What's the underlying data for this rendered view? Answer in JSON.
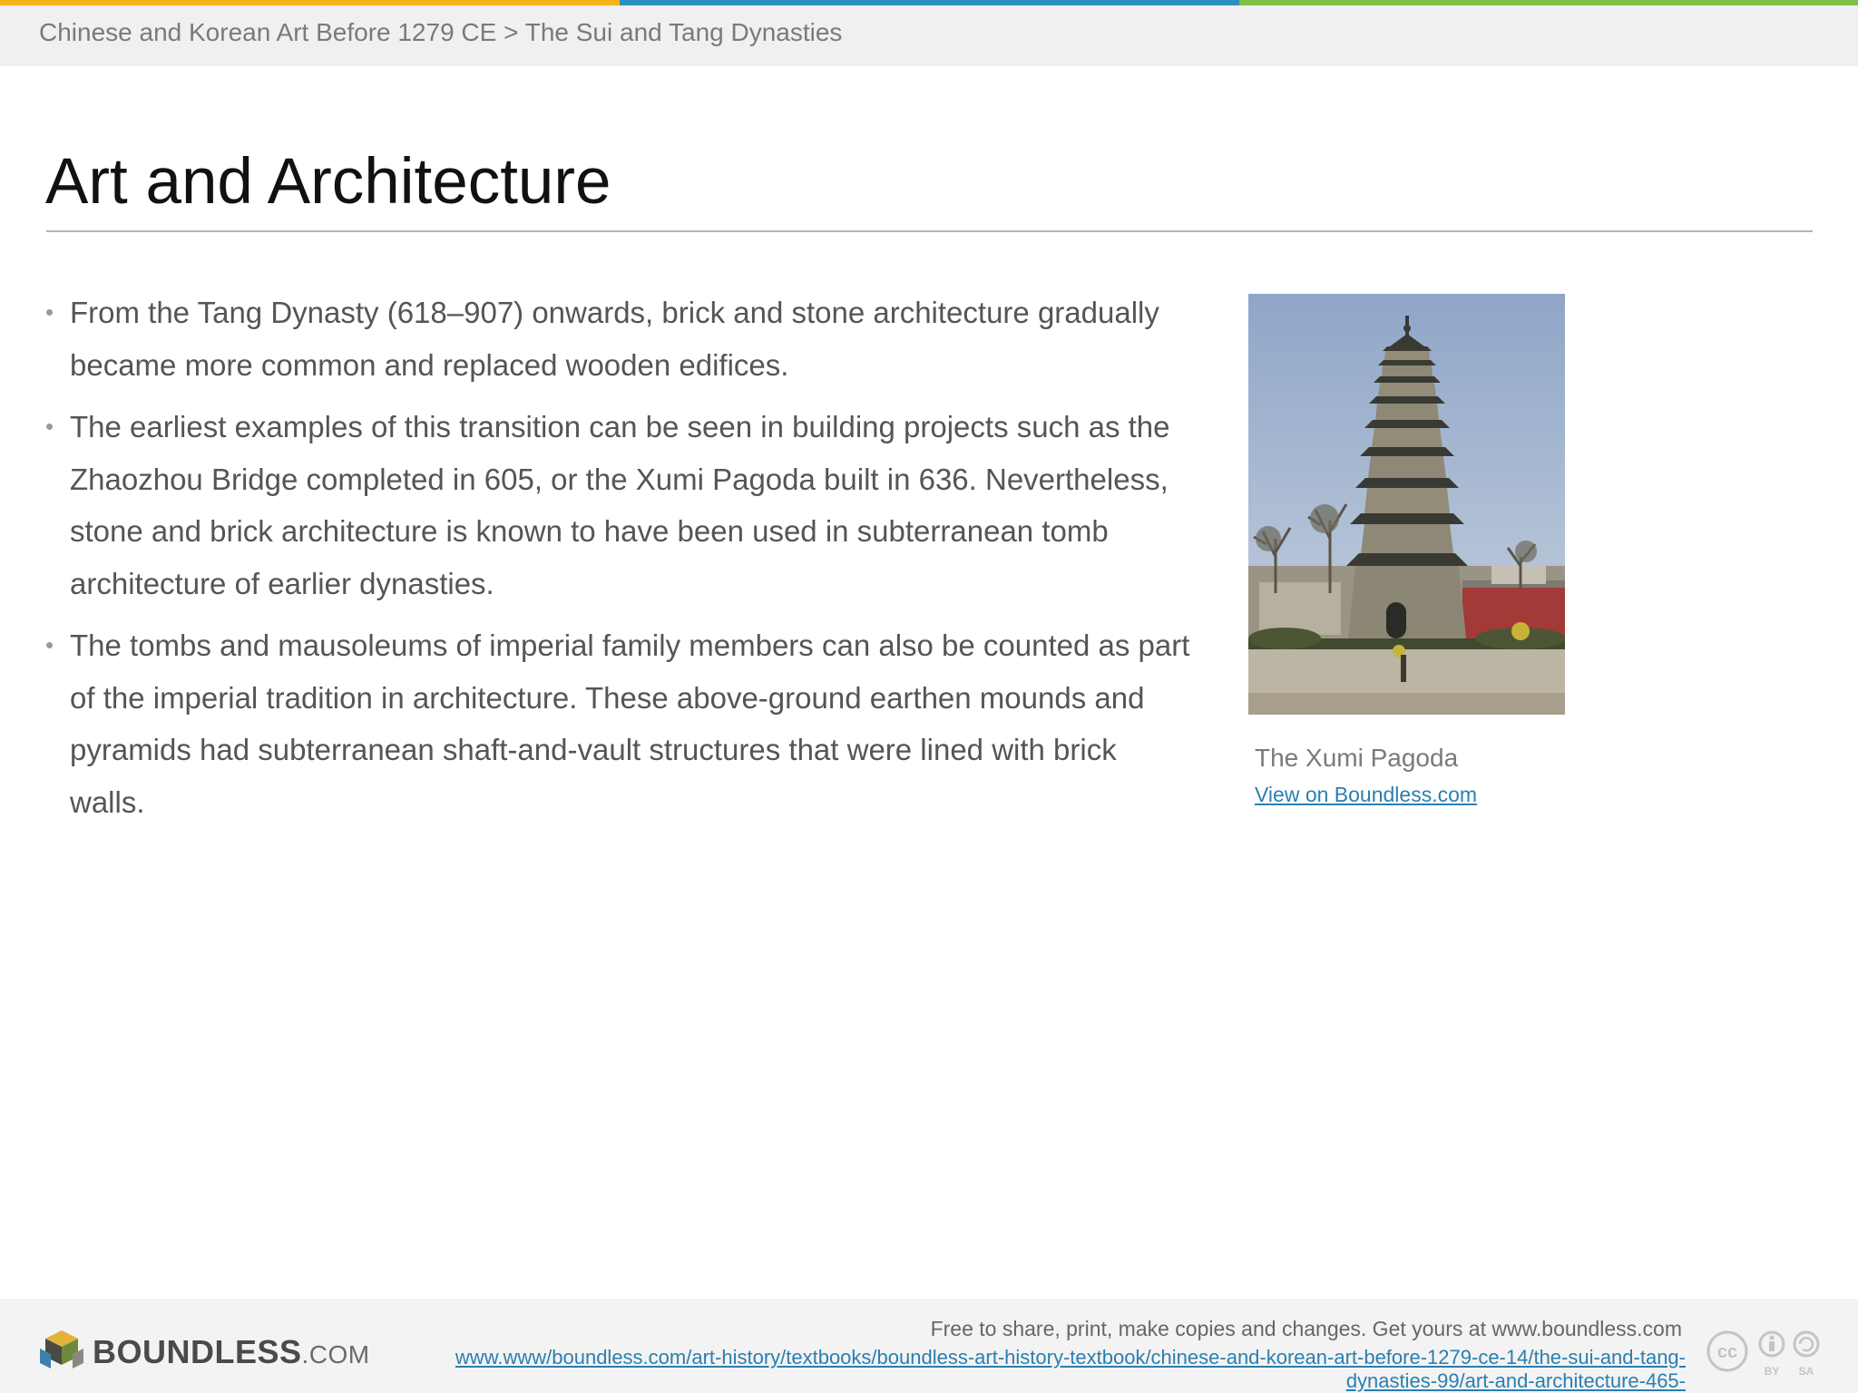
{
  "colors": {
    "stripe_orange": "#f7b51d",
    "stripe_blue": "#2b8fc0",
    "stripe_green": "#7ebf45",
    "link": "#2a7fb0"
  },
  "header": {
    "breadcrumb": "Chinese and Korean Art Before 1279 CE > The Sui and Tang Dynasties"
  },
  "slide": {
    "title": "Art and Architecture",
    "bullets": [
      "From the Tang Dynasty (618–907) onwards, brick and stone architecture gradually became more common and replaced wooden edifices.",
      "The earliest examples of this transition can be seen in building projects such as the Zhaozhou Bridge completed in 605, or the Xumi Pagoda built in 636. Nevertheless, stone and brick architecture is known to have been used in subterranean tomb architecture of earlier dynasties.",
      "The tombs and mausoleums of imperial family members can also be counted as part of the imperial tradition in architecture. These above-ground earthen mounds and pyramids had subterranean shaft-and-vault structures that were lined with brick walls."
    ],
    "bullet_glyph": "•",
    "figure": {
      "icon": "pagoda-photo",
      "caption": "The Xumi Pagoda",
      "link_text": "View on Boundless.com"
    }
  },
  "footer": {
    "logo_text": "BOUNDLESS",
    "logo_suffix": ".COM",
    "license_note": "Free to share, print, make copies and changes. Get yours at www.boundless.com",
    "source_url": "www.www/boundless.com/art-history/textbooks/boundless-art-history-textbook/chinese-and-korean-art-before-1279-ce-14/the-sui-and-tang-dynasties-99/art-and-architecture-465-",
    "cc_labels": {
      "cc": "cc",
      "by": "BY",
      "sa": "SA"
    }
  }
}
